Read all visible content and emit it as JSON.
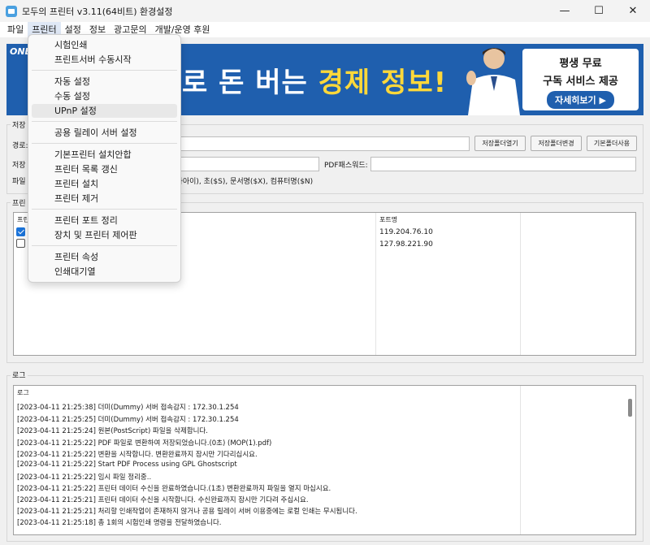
{
  "window": {
    "title": "모두의 프린터 v3.11(64비트) 환경설정",
    "minimize": "—",
    "maximize": "☐",
    "close": "✕"
  },
  "menubar": [
    "파일",
    "프린터",
    "설정",
    "정보",
    "광고문의",
    "개발/운영 후원"
  ],
  "banner": {
    "logo": "ONE",
    "headline_partial": "로 돈 버는 ",
    "headline_highlight": "경제 정보!",
    "box_line1": "평생 무료",
    "box_line2": "구독 서비스 제공",
    "cta": "자세히보기 ▶"
  },
  "save_group": {
    "label": "저장",
    "path_label": "경로:",
    "path_value": "",
    "open_folder_button": "저장폴더열기",
    "change_folder_button": "저장폴더변경",
    "default_folder_button": "기본폴더사용",
    "save_label": "저장",
    "save_value": "",
    "pdf_password_label": "PDF패스워드:",
    "pdf_password_value": "",
    "filename_label": "파일",
    "filename_hint": "대문자아이), 초($S), 문서명($X), 컴퓨터명($N)"
  },
  "printer_group": {
    "label": "프린",
    "column_name": "프린",
    "column_port": "포트명",
    "rows": [
      {
        "checked": true,
        "port": "119.204.76.10"
      },
      {
        "checked": false,
        "port": "127.98.221.90"
      }
    ]
  },
  "log_group": {
    "label": "로그",
    "header": "로그",
    "lines": [
      "[2023-04-11 21:25:38] 더미(Dummy) 서버 접속감지 : 172.30.1.254",
      "[2023-04-11 21:25:25] 더미(Dummy) 서버 접속감지 : 172.30.1.254",
      "[2023-04-11 21:25:24] 원본(PostScript) 파일을 삭제합니다.",
      "[2023-04-11 21:25:22] PDF 파일로 변환하여 저장되었습니다.(0초) (MOP(1).pdf)",
      "[2023-04-11 21:25:22] 변환을 시작합니다. 변환완료까지 잠시만 기다리십시요.",
      "[2023-04-11 21:25:22] Start PDF Process using GPL Ghostscript",
      "[2023-04-11 21:25:22] 임시 파일 정리중..",
      "[2023-04-11 21:25:22] 프린터 데이터 수신을 완료하였습니다.(1초) 변환완료까지 파일을 열지 마십시요.",
      "[2023-04-11 21:25:21] 프린터 데이터 수신을 시작합니다. 수신완료까지 잠시만 기다려 주십시요.",
      "[2023-04-11 21:25:21] 처리할 인쇄작업이 존재하지 않거나 공용 릴레이 서버 이용중에는 로컬 인쇄는 무시됩니다.",
      "[2023-04-11 21:25:18] 총 1회의 시험인쇄 명령을 전달하였습니다."
    ]
  },
  "printer_menu": {
    "items": [
      "시험인쇄",
      "프린트서버 수동시작",
      "자동 설정",
      "수동 설정",
      "UPnP 설정",
      "공용 릴레이 서버 설정",
      "기본프린터 설치안합",
      "프린터 목록 갱신",
      "프린터 설치",
      "프린터 제거",
      "프린터 포트 정리",
      "장치 및 프린터 제어판",
      "프린터 속성",
      "인쇄대기열"
    ],
    "hovered": "UPnP 설정"
  },
  "colors": {
    "banner_blue": "#1f5fae",
    "banner_yellow": "#ffd83a",
    "checkbox_blue": "#1a73d9"
  }
}
